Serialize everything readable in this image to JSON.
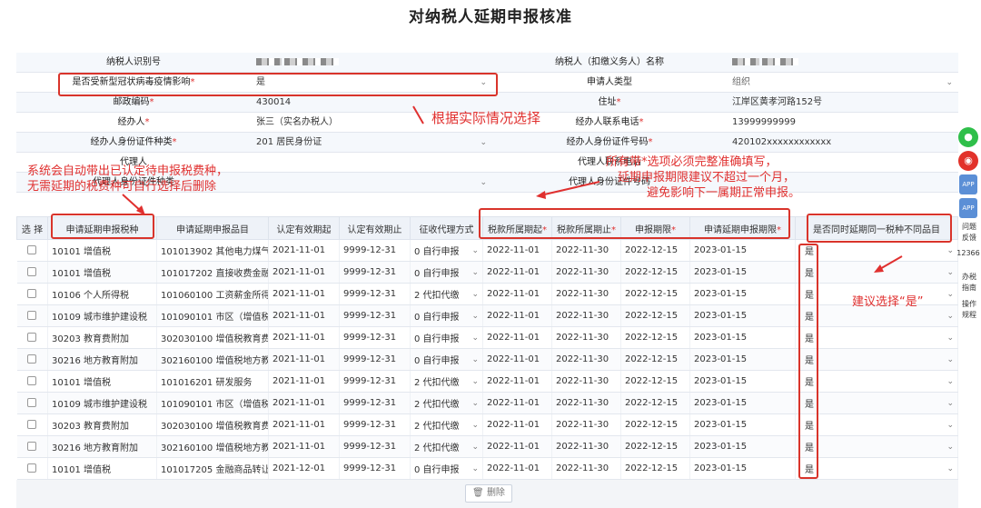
{
  "page_title": "对纳税人延期申报核准",
  "form": {
    "rows": [
      {
        "l1": "纳税人识别号",
        "l1_req": "",
        "v1": "",
        "l2": "纳税人（扣缴义务人）名称",
        "l2_req": "",
        "v2": ""
      },
      {
        "l1": "是否受新型冠状病毒疫情影响",
        "l1_req": "*",
        "v1": "是",
        "l2": "申请人类型",
        "l2_req": "",
        "v2": "组织"
      },
      {
        "l1": "邮政编码",
        "l1_req": "*",
        "v1": "430014",
        "l2": "住址",
        "l2_req": "*",
        "v2": "江岸区黄孝河路152号"
      },
      {
        "l1": "经办人",
        "l1_req": "*",
        "v1": "张三（实名办税人）",
        "l2": "经办人联系电话",
        "l2_req": "*",
        "v2": "13999999999"
      },
      {
        "l1": "经办人身份证件种类",
        "l1_req": "*",
        "v1": "201 居民身份证",
        "l2": "经办人身份证件号码",
        "l2_req": "*",
        "v2": "420102xxxxxxxxxxxx"
      },
      {
        "l1": "代理人",
        "l1_req": "",
        "v1": "",
        "l2": "代理人联系电话",
        "l2_req": "",
        "v2": ""
      },
      {
        "l1": "代理人身份证件种类",
        "l1_req": "",
        "v1": "",
        "l2": "代理人身份证件号码",
        "l2_req": "",
        "v2": ""
      }
    ]
  },
  "table": {
    "headers": [
      "选 择",
      "申请延期申报税种",
      "申请延期申报品目",
      "认定有效期起",
      "认定有效期止",
      "征收代理方式",
      "税款所属期起",
      "税款所属期止",
      "申报期限",
      "申请延期申报期限",
      "是否同时延期同一税种不同品目"
    ],
    "header_req": [
      "",
      "",
      "",
      "",
      "",
      "",
      "*",
      "*",
      "*",
      "*",
      ""
    ],
    "rows": [
      [
        "10101 增值税",
        "101013902 其他电力煤气",
        "2021-11-01",
        "9999-12-31",
        "0 自行申报",
        "2022-11-01",
        "2022-11-30",
        "2022-12-15",
        "2023-01-15",
        "是"
      ],
      [
        "10101 增值税",
        "101017202 直接收费金融",
        "2021-11-01",
        "9999-12-31",
        "0 自行申报",
        "2022-11-01",
        "2022-11-30",
        "2022-12-15",
        "2023-01-15",
        "是"
      ],
      [
        "10106 个人所得税",
        "101060100 工资薪金所得",
        "2021-11-01",
        "9999-12-31",
        "2 代扣代缴",
        "2022-11-01",
        "2022-11-30",
        "2022-12-15",
        "2023-01-15",
        "是"
      ],
      [
        "10109 城市维护建设税",
        "101090101 市区（增值税",
        "2021-11-01",
        "9999-12-31",
        "0 自行申报",
        "2022-11-01",
        "2022-11-30",
        "2022-12-15",
        "2023-01-15",
        "是"
      ],
      [
        "30203 教育费附加",
        "302030100 增值税教育费",
        "2021-11-01",
        "9999-12-31",
        "0 自行申报",
        "2022-11-01",
        "2022-11-30",
        "2022-12-15",
        "2023-01-15",
        "是"
      ],
      [
        "30216 地方教育附加",
        "302160100 增值税地方教",
        "2021-11-01",
        "9999-12-31",
        "0 自行申报",
        "2022-11-01",
        "2022-11-30",
        "2022-12-15",
        "2023-01-15",
        "是"
      ],
      [
        "10101 增值税",
        "101016201 研发服务",
        "2021-11-01",
        "9999-12-31",
        "2 代扣代缴",
        "2022-11-01",
        "2022-11-30",
        "2022-12-15",
        "2023-01-15",
        "是"
      ],
      [
        "10109 城市维护建设税",
        "101090101 市区（增值税",
        "2021-11-01",
        "9999-12-31",
        "2 代扣代缴",
        "2022-11-01",
        "2022-11-30",
        "2022-12-15",
        "2023-01-15",
        "是"
      ],
      [
        "30203 教育费附加",
        "302030100 增值税教育费",
        "2021-11-01",
        "9999-12-31",
        "2 代扣代缴",
        "2022-11-01",
        "2022-11-30",
        "2022-12-15",
        "2023-01-15",
        "是"
      ],
      [
        "30216 地方教育附加",
        "302160100 增值税地方教",
        "2021-11-01",
        "9999-12-31",
        "2 代扣代缴",
        "2022-11-01",
        "2022-11-30",
        "2022-12-15",
        "2023-01-15",
        "是"
      ],
      [
        "10101 增值税",
        "101017205 金融商品转让",
        "2021-12-01",
        "9999-12-31",
        "0 自行申报",
        "2022-11-01",
        "2022-11-30",
        "2022-12-15",
        "2023-01-15",
        "是"
      ]
    ]
  },
  "delete_button": {
    "icon": "trash-icon",
    "label": "删除"
  },
  "annotations": {
    "choose_by_situation": "根据实际情况选择",
    "auto_tax_line1": "系统会自动带出已认定待申报税费种，",
    "auto_tax_line2": "无需延期的税费种可自行选择后删除",
    "required_line1": "所有带*选项必须完整准确填写，",
    "required_line2": "延期申报期限建议不超过一个月，",
    "required_line3": "避免影响下一属期正常申报。",
    "suggest_yes": "建议选择“是”",
    "color": "#e0302f"
  },
  "sidebar": {
    "wechat_icon": "wechat-icon",
    "weibo_icon": "weibo-icon",
    "app1": "APP",
    "app2": "APP",
    "feedback": "问题反馈",
    "hotline": "12366",
    "guide": "办税指南",
    "manual": "操作规程"
  }
}
